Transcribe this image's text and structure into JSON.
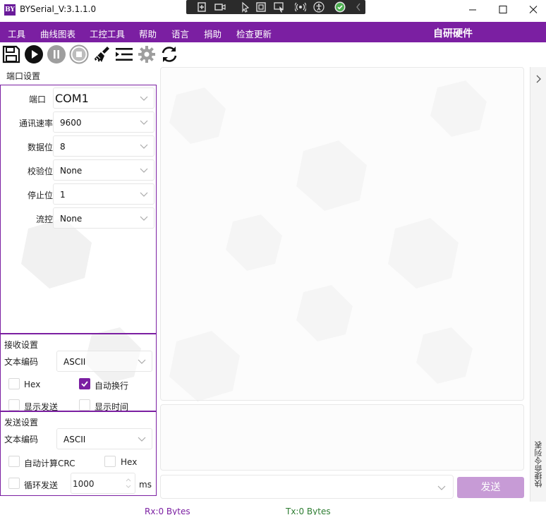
{
  "window": {
    "logo_text": "BY",
    "title": "BYSerial_V:3.1.1.0"
  },
  "menu": {
    "items": [
      "工具",
      "曲线图表",
      "工控工具",
      "帮助",
      "语言",
      "捐助",
      "检查更新"
    ],
    "brand": "自研硬件"
  },
  "toolbar": {
    "icons": [
      "save-icon",
      "play-icon",
      "pause-icon",
      "stop-icon",
      "broom-icon",
      "list-indent-icon",
      "gear-icon",
      "refresh-icon"
    ]
  },
  "port_settings": {
    "title": "端口设置",
    "port_label": "端口",
    "port_value": "COM1",
    "baud_label": "通讯速率",
    "baud_value": "9600",
    "databits_label": "数据位",
    "databits_value": "8",
    "parity_label": "校验位",
    "parity_value": "None",
    "stopbits_label": "停止位",
    "stopbits_value": "1",
    "flow_label": "流控",
    "flow_value": "None"
  },
  "recv_settings": {
    "title": "接收设置",
    "encoding_label": "文本编码",
    "encoding_value": "ASCII",
    "hex_label": "Hex",
    "hex_checked": false,
    "autowrap_label": "自动换行",
    "autowrap_checked": true,
    "show_send_label": "显示发送",
    "show_send_checked": false,
    "show_time_label": "显示时间",
    "show_time_checked": false
  },
  "send_settings": {
    "title": "发送设置",
    "encoding_label": "文本编码",
    "encoding_value": "ASCII",
    "crc_label": "自动计算CRC",
    "crc_checked": false,
    "hex_label": "Hex",
    "hex_checked": false,
    "loop_label": "循环发送",
    "loop_checked": false,
    "interval_value": "1000",
    "interval_unit": "ms"
  },
  "send": {
    "button_label": "发送"
  },
  "side": {
    "quick_commands_label": "快捷命令列表"
  },
  "status": {
    "rx": "Rx:0 Bytes",
    "tx": "Tx:0 Bytes"
  },
  "colors": {
    "accent": "#7b1fa2",
    "send_button": "#c79bd6",
    "tx_text": "#2e7d32"
  }
}
